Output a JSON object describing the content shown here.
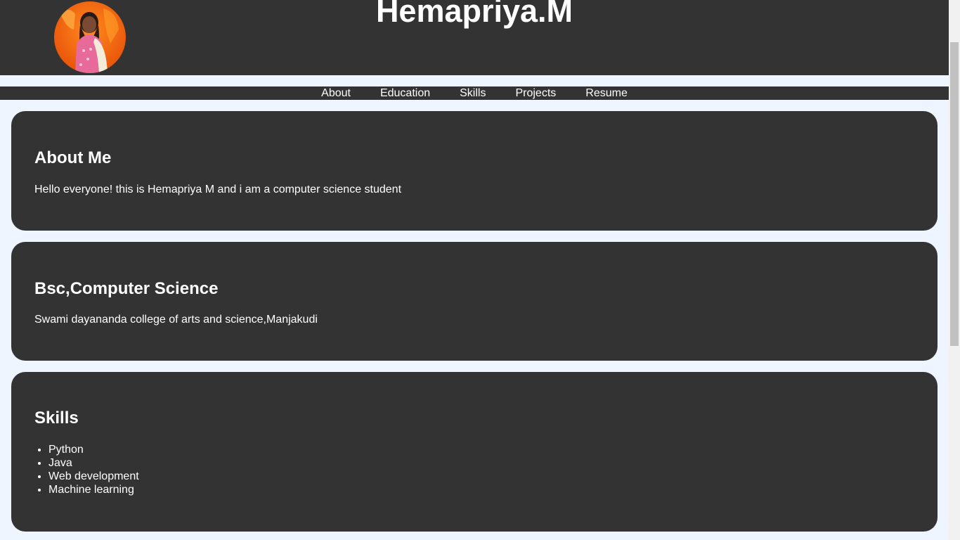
{
  "header": {
    "title": "Hemapriya.M"
  },
  "nav": {
    "items": [
      "About",
      "Education",
      "Skills",
      "Projects",
      "Resume"
    ]
  },
  "about": {
    "heading": "About Me",
    "text": "Hello everyone! this is Hemapriya M and i am a computer science student"
  },
  "education": {
    "heading": "Bsc,Computer Science",
    "text": "Swami dayananda college of arts and science,Manjakudi"
  },
  "skills": {
    "heading": "Skills",
    "items": [
      "Python",
      "Java",
      "Web development",
      "Machine learning"
    ]
  },
  "colors": {
    "header_bg": "#333333",
    "page_bg": "#eef5fe",
    "text": "#ffffff"
  }
}
